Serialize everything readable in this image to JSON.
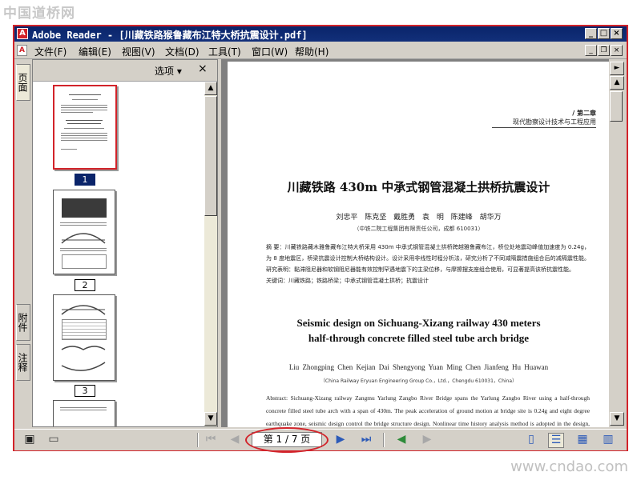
{
  "watermark": {
    "top": "中国道桥网",
    "bottom": "www.cndao.com"
  },
  "window": {
    "title": "Adobe Reader - [川藏铁路猴鲁藏布江特大桥抗震设计.pdf]"
  },
  "window_controls": {
    "minimize": "_",
    "maximize": "□",
    "close": "×"
  },
  "menu": {
    "items": [
      "文件(F)",
      "编辑(E)",
      "视图(V)",
      "文档(D)",
      "工具(T)",
      "窗口(W)",
      "帮助(H)"
    ],
    "doc_controls": {
      "minimize": "_",
      "restore": "❐",
      "close": "×"
    }
  },
  "left_tabs": [
    "页面",
    "附件",
    "注释"
  ],
  "thumbnails": {
    "options_label": "选项 ▾",
    "close": "×",
    "pages": [
      {
        "label": "1",
        "selected": true
      },
      {
        "label": "2",
        "selected": false
      },
      {
        "label": "3",
        "selected": false
      }
    ]
  },
  "document": {
    "chapter_label": "/ 第二章",
    "chapter_sub": "现代勘察设计技术与工程应用",
    "cn_title": "川藏铁路 430m 中承式钢管混凝土拱桥抗震设计",
    "cn_authors": "刘忠平 陈克坚 戴胜勇 袁 明 陈建峰 胡华万",
    "cn_affiliation": "（中铁二院工程集团有限责任公司，成都 610031）",
    "cn_abstract": "摘 要：川藏铁路藏木雅鲁藏布江特大桥采用 430m 中承式钢管混凝土拱桥跨越雅鲁藏布江，桥位处地震动峰值加速度为 0.24g，为 8 度地震区，桥梁抗震设计控制大桥结构设计。设计采用非线性时程分析法，研究分析了不同减隔震措施组合后的减隔震性能。研究表明：黏滞阻尼器和软钢阻尼器能有效控制罕遇地震下的主梁位移，与摩擦摆支座组合使用，可显著提高该桥抗震性能。",
    "cn_keywords": "关键词：川藏铁路；铁路桥梁；中承式钢管混凝土拱桥；抗震设计",
    "en_title_line1": "Seismic design on Sichuang-Xizang railway 430 meters",
    "en_title_line2": "half-through concrete filled steel tube arch bridge",
    "en_authors": "Liu Zhongping   Chen Kejian   Dai Shengyong   Yuan Ming   Chen Jianfeng   Hu Huawan",
    "en_affiliation": "（China Railway Eryuan Engineering Group Co.，Ltd.，Chengdu 610031，China）",
    "en_abstract": "Abstract: Sichuang-Xizang railway Zangmu Yarlung Zangbo River Bridge spans the Yarlung Zangbo River using a half-through concrete filled steel tube arch with a span of 430m. The peak acceleration of ground motion at bridge site is 0.24g and eight degree earthquake zone, seismic design control the bridge structure design. Nonlinear time history analysis method is adopted in the design, and the seismic isolation performance of the structure with different combination of seismic isolation measures is studied and analyzed. Research shows: Viscous damper and hysteretic damper can effectively control the displacement of main girder under rare earthquake, the seismic performance of the bridge can be significantly improved with the"
  },
  "statusbar": {
    "page_indicator": "第 1 / 7 页",
    "accent_color": "#d2232a"
  },
  "icons": [
    "pdf-app-icon",
    "first-page-icon",
    "prev-page-icon",
    "next-page-icon",
    "last-page-icon",
    "back-icon",
    "forward-icon",
    "single-page-icon",
    "continuous-icon",
    "facing-icon",
    "continuous-facing-icon"
  ]
}
